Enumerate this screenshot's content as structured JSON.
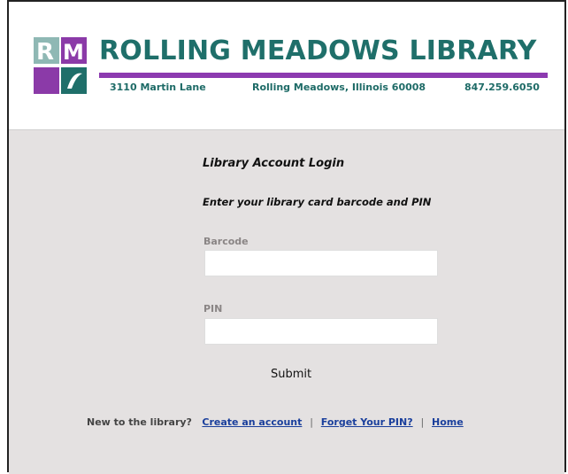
{
  "header": {
    "logo_letters": "RM",
    "library_name": "ROLLING MEADOWS LIBRARY",
    "address": "3110 Martin Lane",
    "city": "Rolling Meadows, Illinois 60008",
    "phone": "847.259.6050"
  },
  "login": {
    "title": "Library Account Login",
    "instructions": "Enter your library card barcode and PIN",
    "barcode_label": "Barcode",
    "barcode_value": "",
    "pin_label": "PIN",
    "pin_value": "",
    "submit_label": "Submit"
  },
  "footer_links": {
    "prompt": "New to the library?",
    "create_account": "Create an account",
    "forgot_pin": "Forget Your PIN?",
    "home": "Home",
    "separator": "|"
  },
  "colors": {
    "brand_teal": "#1f6f6a",
    "brand_purple": "#8c3ab0",
    "link_blue": "#1a3f9c",
    "panel_gray": "#e4e1e1"
  }
}
